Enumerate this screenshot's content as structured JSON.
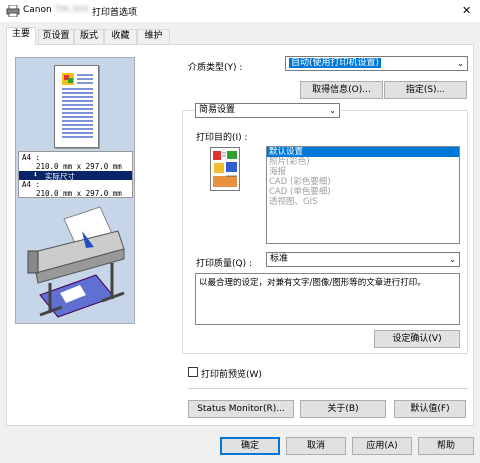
{
  "window": {
    "title_prefix": "Canon",
    "title_model": "TM-300",
    "title_suffix": "打印首选项",
    "close_glyph": "✕"
  },
  "tabs": [
    {
      "label": "主要"
    },
    {
      "label": "页设置"
    },
    {
      "label": "版式"
    },
    {
      "label": "收藏"
    },
    {
      "label": "维护"
    }
  ],
  "preview": {
    "paper_top": "A4 :",
    "paper_top_size": "210.0 mm x 297.0 mm",
    "scale_label": "实际尺寸",
    "paper_bottom": "A4 :",
    "paper_bottom_size": "210.0 mm x 297.0 mm"
  },
  "media": {
    "label": "介质类型(Y) :",
    "value": "自动(使用打印机设置)",
    "get_info_button": "取得信息(O)...",
    "specify_button": "指定(S)..."
  },
  "mode": {
    "value": "简易设置"
  },
  "purpose": {
    "label": "打印目的(I) :",
    "items": [
      {
        "label": "默认设置",
        "selected": true
      },
      {
        "label": "照片(彩色)",
        "selected": false
      },
      {
        "label": "海报",
        "selected": false
      },
      {
        "label": "CAD (彩色要细)",
        "selected": false
      },
      {
        "label": "CAD (单色要细)",
        "selected": false
      },
      {
        "label": "透视图、GIS",
        "selected": false
      }
    ]
  },
  "quality": {
    "label": "打印质量(Q) :",
    "value": "标准"
  },
  "description": "以最合理的设定，对兼有文字/图像/图形等的文章进行打印。",
  "view_settings_button": "设定确认(V)",
  "preview_before_print": "打印前预览(W)",
  "bottom_buttons": {
    "status_monitor": "Status Monitor(R)...",
    "about": "关于(B)",
    "defaults": "默认值(F)"
  },
  "dialog_buttons": {
    "ok": "确定",
    "cancel": "取消",
    "apply": "应用(A)",
    "help": "帮助"
  },
  "colors": {
    "accent": "#0078d7",
    "scale_bar": "#0a246a",
    "paper_lines": "#3050c0"
  }
}
